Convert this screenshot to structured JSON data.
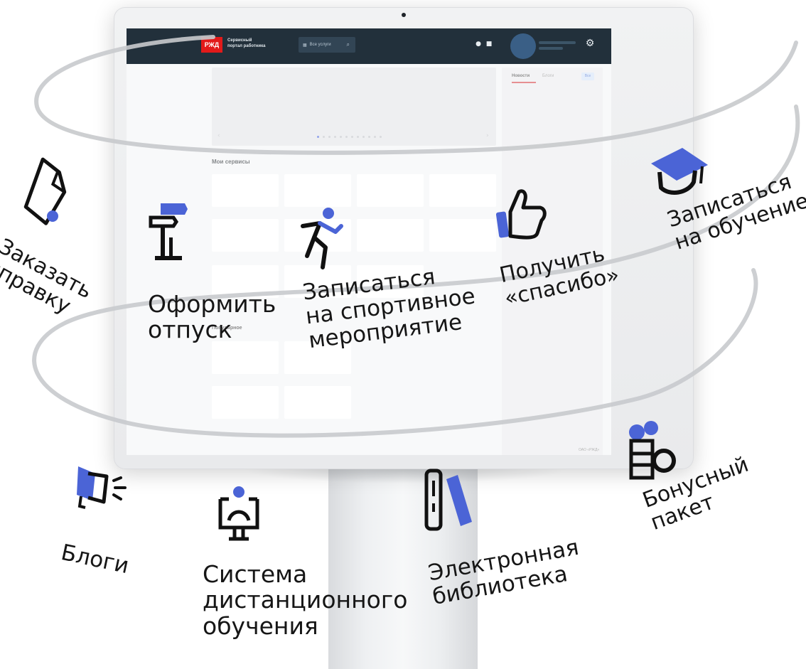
{
  "colors": {
    "accent_blue": "#4b64d6",
    "header_dark": "#22303b",
    "brand_red": "#e21a1a",
    "swirl_gray": "#c8cacd"
  },
  "portal": {
    "logo_text": "РЖД",
    "title": "Сервисный\nпортал работника",
    "all_services_label": "Все услуги"
  },
  "screen": {
    "news_tab": "Новости",
    "blogs_tab": "Блоги",
    "all_button": "Все",
    "my_services_title": "Мои сервисы",
    "popular_title": "Популярное",
    "footer_company": "ОАО «РЖД»",
    "carousel_dots": 12,
    "carousel_active_index": 0
  },
  "features": [
    {
      "id": "order-certificate",
      "label": "Заказать\nсправку",
      "icon": "document-icon"
    },
    {
      "id": "vacation",
      "label": "Оформить\nотпуск",
      "icon": "signpost-icon"
    },
    {
      "id": "sport-event",
      "label": "Записаться\nна спортивное\nмероприятие",
      "icon": "runner-icon"
    },
    {
      "id": "thanks",
      "label": "Получить\n«спасибо»",
      "icon": "thumbs-up-icon"
    },
    {
      "id": "training",
      "label": "Записаться\nна обучение",
      "icon": "graduation-cap-icon"
    },
    {
      "id": "blogs",
      "label": "Блоги",
      "icon": "megaphone-icon"
    },
    {
      "id": "distance-learning",
      "label": "Система\nдистанционного\nобучения",
      "icon": "monitor-user-icon"
    },
    {
      "id": "library",
      "label": "Электронная\nбиблиотека",
      "icon": "books-icon"
    },
    {
      "id": "bonus",
      "label": "Бонусный\nпакет",
      "icon": "gift-icon"
    }
  ]
}
